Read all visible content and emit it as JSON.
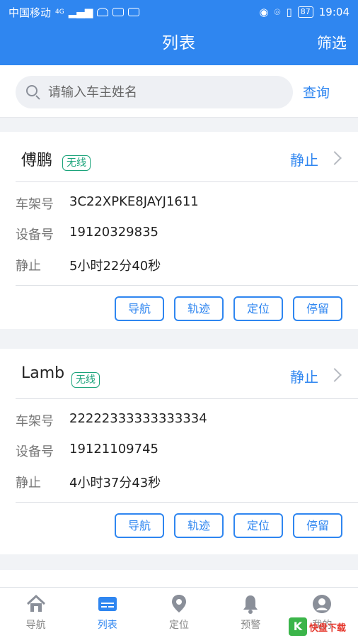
{
  "status": {
    "carrier": "中国移动",
    "network": "4G",
    "battery": "87",
    "time": "19:04"
  },
  "header": {
    "title": "列表",
    "filter_label": "筛选"
  },
  "search": {
    "placeholder": "请输入车主姓名",
    "value": "",
    "button_label": "查询"
  },
  "vehicles": [
    {
      "owner": "傅鹏",
      "badge": "无线",
      "state": "静止",
      "fields": [
        {
          "key": "车架号",
          "value": "3C22XPKE8JAYJ1611"
        },
        {
          "key": "设备号",
          "value": "19120329835"
        },
        {
          "key": "静止",
          "value": "5小时22分40秒"
        }
      ],
      "actions": [
        "导航",
        "轨迹",
        "定位",
        "停留"
      ]
    },
    {
      "owner": "Lamb",
      "badge": "无线",
      "state": "静止",
      "fields": [
        {
          "key": "车架号",
          "value": "22222333333333334"
        },
        {
          "key": "设备号",
          "value": "19121109745"
        },
        {
          "key": "静止",
          "value": "4小时37分43秒"
        }
      ],
      "actions": [
        "导航",
        "轨迹",
        "定位",
        "停留"
      ]
    }
  ],
  "tabs": [
    {
      "label": "导航",
      "icon": "home-icon"
    },
    {
      "label": "列表",
      "icon": "list-icon",
      "active": true
    },
    {
      "label": "定位",
      "icon": "location-pin-icon"
    },
    {
      "label": "预警",
      "icon": "bell-icon"
    },
    {
      "label": "我的",
      "icon": "user-icon"
    }
  ],
  "watermark": {
    "logo_char": "K",
    "text": "快盘下载"
  },
  "colors": {
    "primary": "#2f86f0",
    "badge": "#1aa37a",
    "background": "#f1f3f6"
  }
}
